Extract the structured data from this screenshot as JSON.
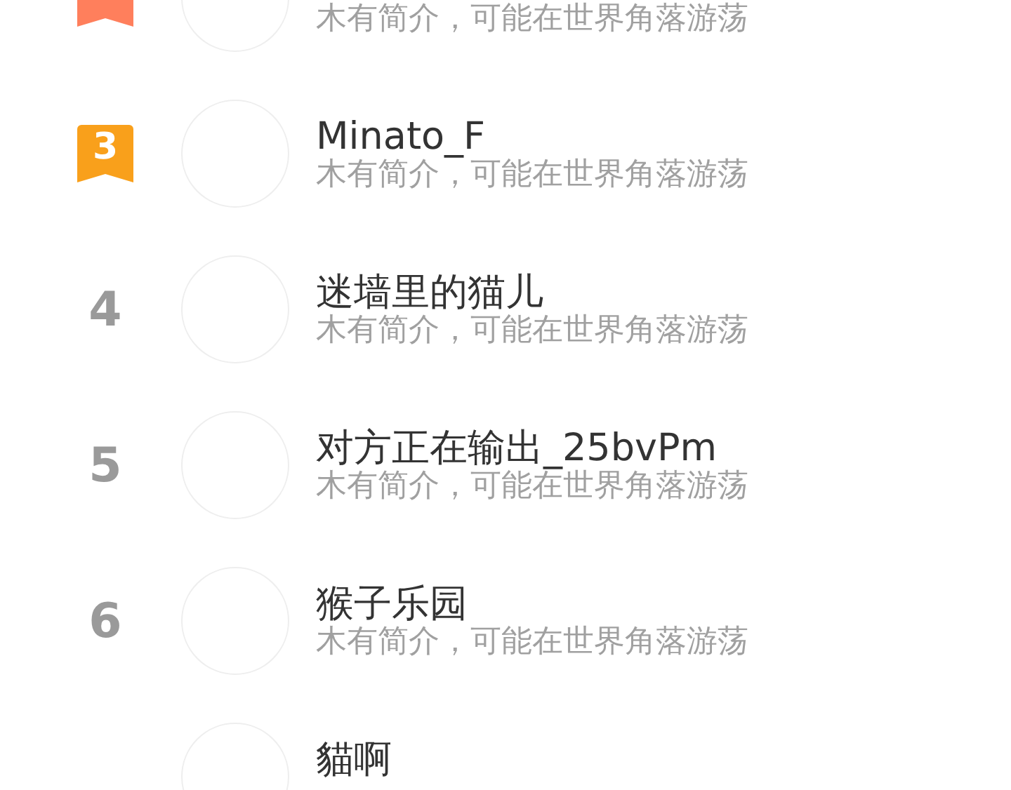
{
  "ranking": [
    {
      "kind": "badge",
      "color": "#ff7f5c",
      "subtitle": "木有简介，可能在世界角落游荡"
    },
    {
      "kind": "badge",
      "rank": "3",
      "color": "#f9a01b",
      "name": "Minato_F",
      "subtitle": "木有简介，可能在世界角落游荡"
    },
    {
      "kind": "number",
      "rank": "4",
      "name": "迷墙里的猫儿",
      "subtitle": "木有简介，可能在世界角落游荡"
    },
    {
      "kind": "number",
      "rank": "5",
      "name": "对方正在输出_25bvPm",
      "subtitle": "木有简介，可能在世界角落游荡"
    },
    {
      "kind": "number",
      "rank": "6",
      "name": "猴子乐园",
      "subtitle": "木有简介，可能在世界角落游荡"
    },
    {
      "kind": "number",
      "name": "貓啊"
    }
  ]
}
